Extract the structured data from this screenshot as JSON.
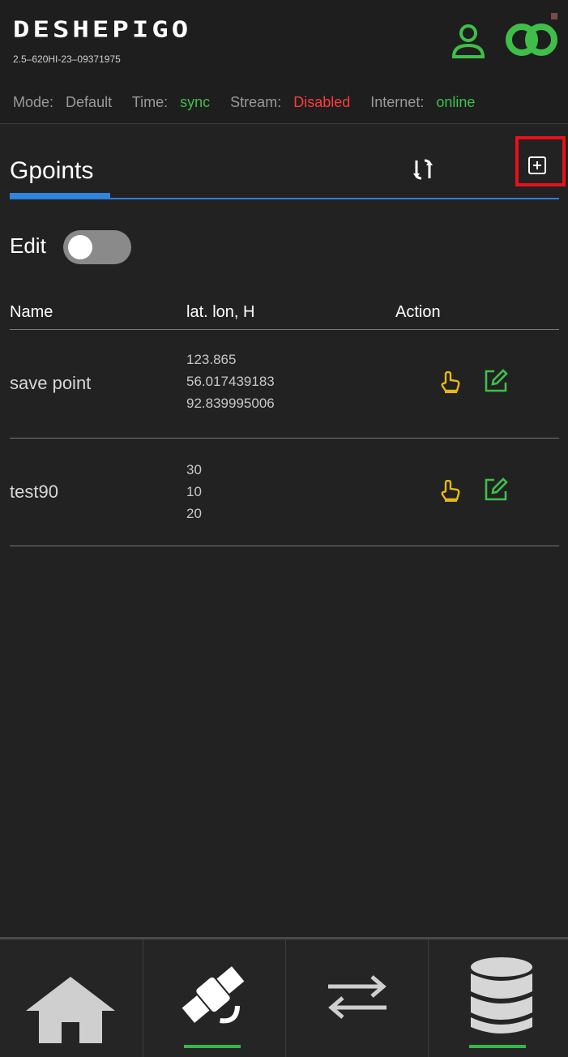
{
  "header": {
    "brand": "DESHEPIGO",
    "serial": "2.5–620HI-23–09371975",
    "status": {
      "mode_label": "Mode:",
      "mode_value": "Default",
      "time_label": "Time:",
      "time_value": "sync",
      "stream_label": "Stream:",
      "stream_value": "Disabled",
      "internet_label": "Internet:",
      "internet_value": "online"
    }
  },
  "tab": {
    "title": "Gpoints"
  },
  "edit": {
    "label": "Edit",
    "enabled": false
  },
  "table": {
    "columns": [
      "Name",
      "lat. lon, H",
      "Action"
    ],
    "rows": [
      {
        "name": "save point",
        "lat": "123.865",
        "lon": "56.017439183",
        "h": "92.839995006"
      },
      {
        "name": "test90",
        "lat": "30",
        "lon": "10",
        "h": "20"
      }
    ]
  },
  "nav": {
    "items": [
      {
        "icon": "home-icon",
        "active": false
      },
      {
        "icon": "satellite-icon",
        "active": true
      },
      {
        "icon": "transfer-arrows-icon",
        "active": false
      },
      {
        "icon": "database-icon",
        "active": true
      }
    ]
  },
  "colors": {
    "accent_green": "#3fbf4a",
    "alert_red": "#ff3b3b",
    "tab_blue": "#2f86e0",
    "highlight_red": "#e8101a",
    "hand_yellow": "#e8b81a"
  }
}
